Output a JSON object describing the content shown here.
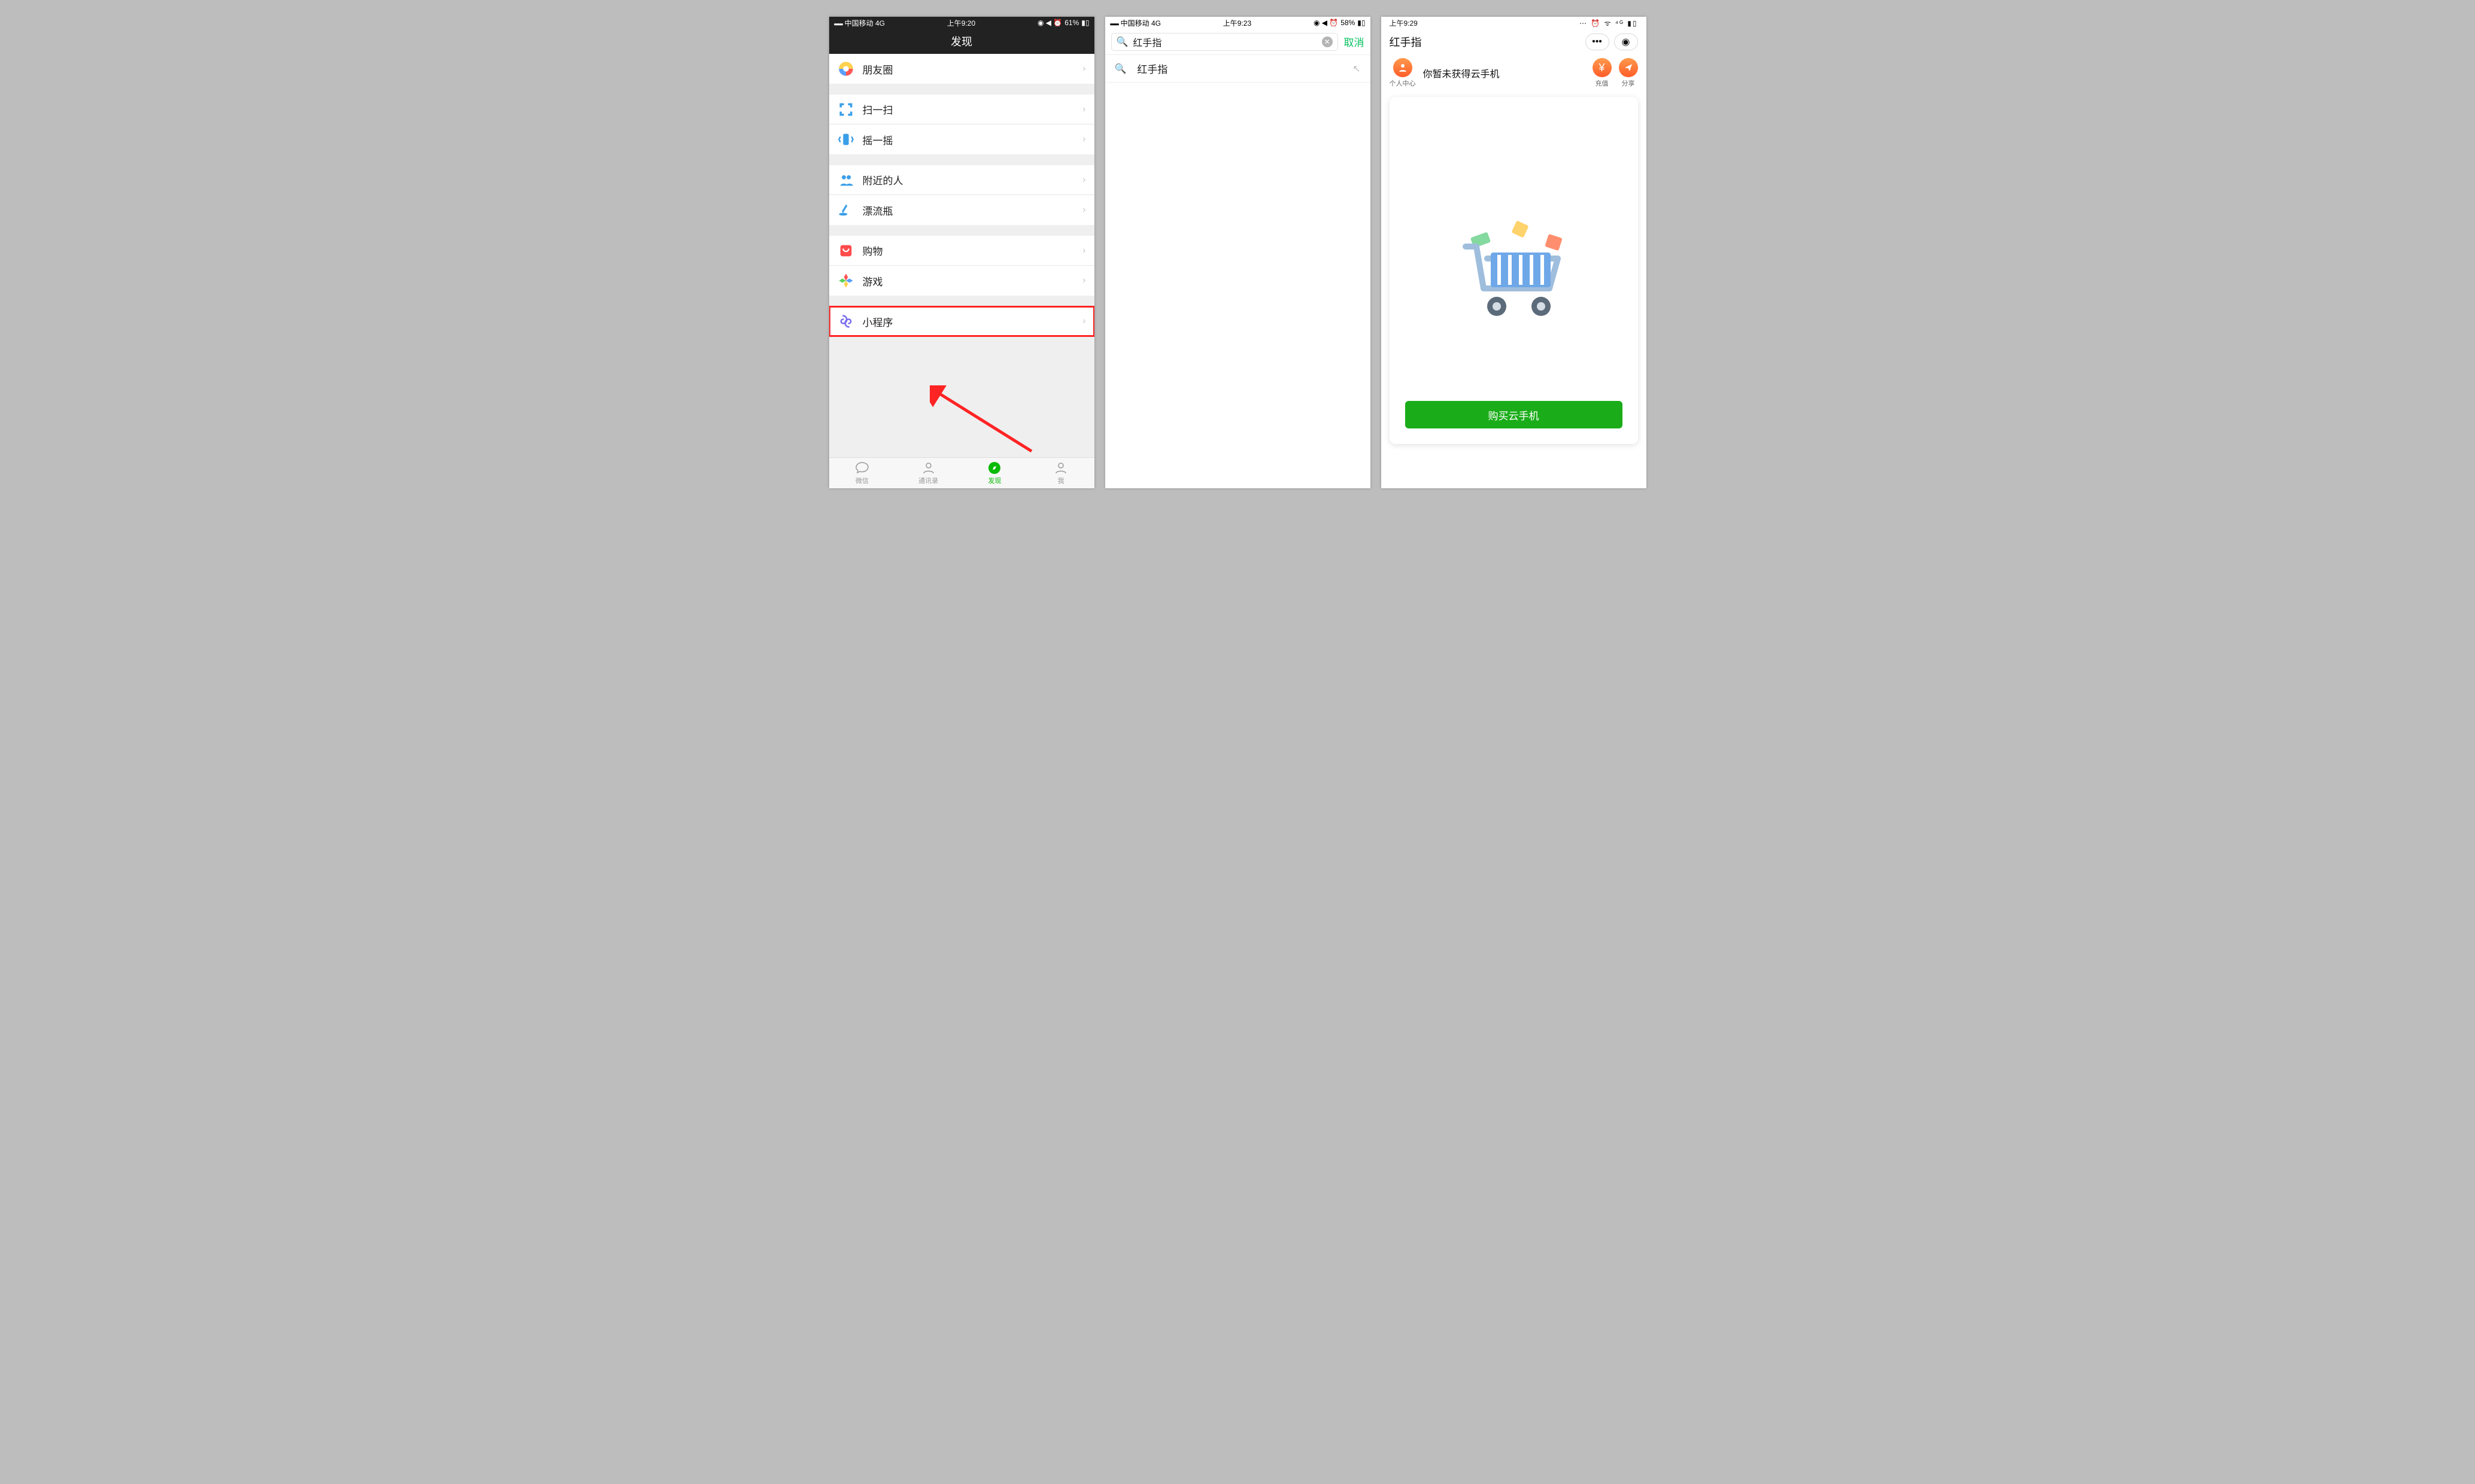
{
  "phone1": {
    "status": {
      "carrier": "中国移动  4G",
      "time": "上午9:20",
      "battery": "61%"
    },
    "nav_title": "发现",
    "sections": [
      [
        {
          "icon": "moments",
          "label": "朋友圈"
        }
      ],
      [
        {
          "icon": "scan",
          "label": "扫一扫"
        },
        {
          "icon": "shake",
          "label": "摇一摇"
        }
      ],
      [
        {
          "icon": "nearby",
          "label": "附近的人"
        },
        {
          "icon": "bottle",
          "label": "漂流瓶"
        }
      ],
      [
        {
          "icon": "shop",
          "label": "购物"
        },
        {
          "icon": "game",
          "label": "游戏"
        }
      ],
      [
        {
          "icon": "miniprog",
          "label": "小程序"
        }
      ]
    ],
    "tabs": [
      {
        "icon": "chat",
        "label": "微信"
      },
      {
        "icon": "contacts",
        "label": "通讯录"
      },
      {
        "icon": "discover",
        "label": "发现",
        "active": true
      },
      {
        "icon": "me",
        "label": "我"
      }
    ]
  },
  "phone2": {
    "status": {
      "carrier": "中国移动  4G",
      "time": "上午9:23",
      "battery": "58%"
    },
    "search": {
      "query": "红手指",
      "cancel": "取消"
    },
    "result": {
      "text": "红手指"
    }
  },
  "phone3": {
    "status": {
      "time": "上午9:29"
    },
    "nav_title": "红手指",
    "top": {
      "profile": "个人中心",
      "message": "你暂未获得云手机",
      "recharge": "充值",
      "share": "分享"
    },
    "buy": "购买云手机"
  }
}
